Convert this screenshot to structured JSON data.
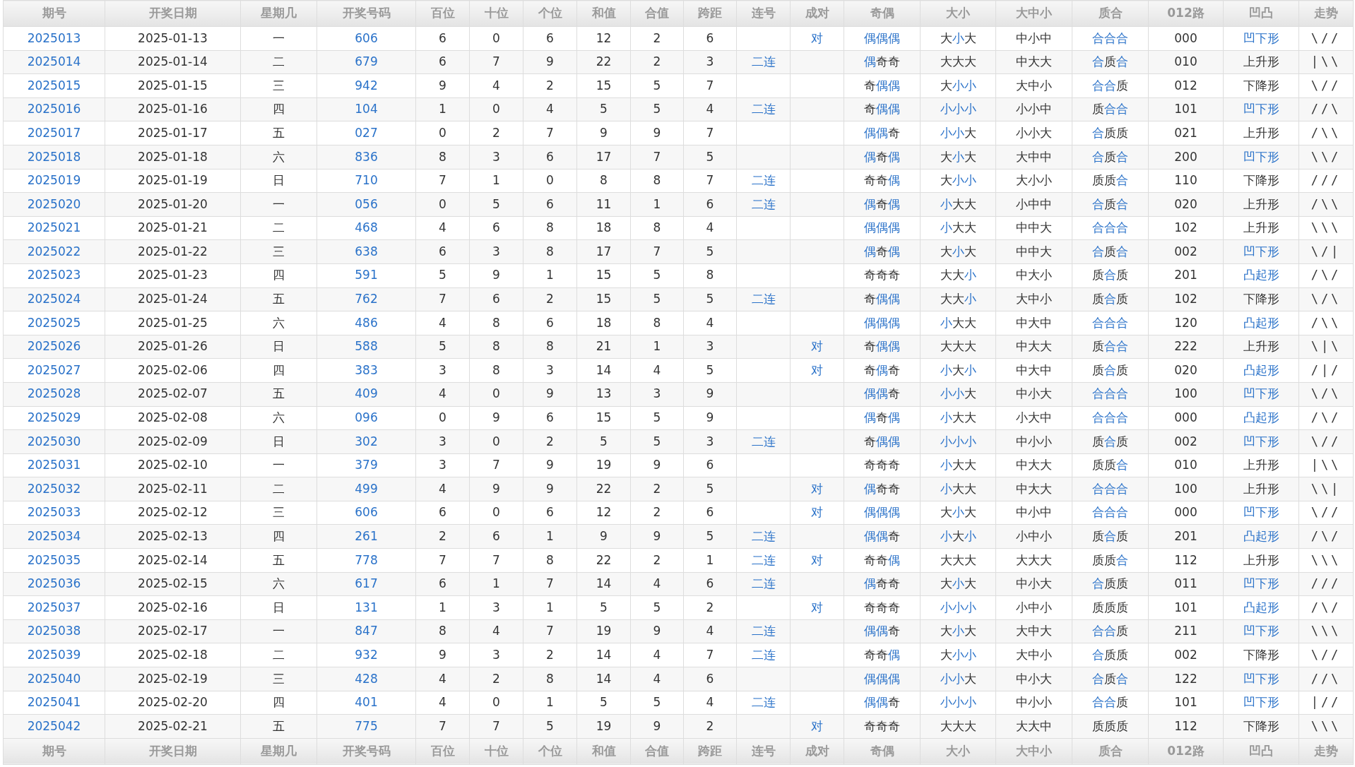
{
  "header": [
    "期号",
    "开奖日期",
    "星期几",
    "开奖号码",
    "百位",
    "十位",
    "个位",
    "和值",
    "合值",
    "跨距",
    "连号",
    "成对",
    "奇偶",
    "大小",
    "大中小",
    "质合",
    "012路",
    "凹凸",
    "走势"
  ],
  "rows": [
    {
      "issue": "2025013",
      "date": "2025-01-13",
      "weekday": "一",
      "number": "606",
      "hundreds": "6",
      "tens": "0",
      "units": "6",
      "sum": "12",
      "sum_tail": "2",
      "span": "6",
      "pair": "对",
      "odd_even": {
        "text": "偶偶偶",
        "highlighted": [
          true,
          true,
          true
        ]
      },
      "big_small": {
        "text": "大小大",
        "highlighted": [
          false,
          true,
          false
        ]
      },
      "big_mid_small": "中小中",
      "prime_composite": {
        "text": "合合合",
        "highlighted": [
          true,
          true,
          true
        ]
      },
      "route_012": "000",
      "shape": {
        "text": "凹下形",
        "highlighted": true
      },
      "trend": "\\//"
    },
    {
      "issue": "2025014",
      "date": "2025-01-14",
      "weekday": "二",
      "number": "679",
      "hundreds": "6",
      "tens": "7",
      "units": "9",
      "sum": "22",
      "sum_tail": "2",
      "span": "3",
      "consecutive": "二连",
      "odd_even": {
        "text": "偶奇奇",
        "highlighted": [
          true,
          false,
          false
        ]
      },
      "big_small": {
        "text": "大大大",
        "highlighted": [
          false,
          false,
          false
        ]
      },
      "big_mid_small": "中大大",
      "prime_composite": {
        "text": "合质合",
        "highlighted": [
          true,
          false,
          true
        ]
      },
      "route_012": "010",
      "shape": {
        "text": "上升形",
        "highlighted": false
      },
      "trend": "|\\\\"
    },
    {
      "issue": "2025015",
      "date": "2025-01-15",
      "weekday": "三",
      "number": "942",
      "hundreds": "9",
      "tens": "4",
      "units": "2",
      "sum": "15",
      "sum_tail": "5",
      "span": "7",
      "odd_even": {
        "text": "奇偶偶",
        "highlighted": [
          false,
          true,
          true
        ]
      },
      "big_small": {
        "text": "大小小",
        "highlighted": [
          false,
          true,
          true
        ]
      },
      "big_mid_small": "大中小",
      "prime_composite": {
        "text": "合合质",
        "highlighted": [
          true,
          true,
          false
        ]
      },
      "route_012": "012",
      "shape": {
        "text": "下降形",
        "highlighted": false
      },
      "trend": "\\//"
    },
    {
      "issue": "2025016",
      "date": "2025-01-16",
      "weekday": "四",
      "number": "104",
      "hundreds": "1",
      "tens": "0",
      "units": "4",
      "sum": "5",
      "sum_tail": "5",
      "span": "4",
      "consecutive": "二连",
      "odd_even": {
        "text": "奇偶偶",
        "highlighted": [
          false,
          true,
          true
        ]
      },
      "big_small": {
        "text": "小小小",
        "highlighted": [
          true,
          true,
          true
        ]
      },
      "big_mid_small": "小小中",
      "prime_composite": {
        "text": "质合合",
        "highlighted": [
          false,
          true,
          true
        ]
      },
      "route_012": "101",
      "shape": {
        "text": "凹下形",
        "highlighted": true
      },
      "trend": "//\\"
    },
    {
      "issue": "2025017",
      "date": "2025-01-17",
      "weekday": "五",
      "number": "027",
      "hundreds": "0",
      "tens": "2",
      "units": "7",
      "sum": "9",
      "sum_tail": "9",
      "span": "7",
      "odd_even": {
        "text": "偶偶奇",
        "highlighted": [
          true,
          true,
          false
        ]
      },
      "big_small": {
        "text": "小小大",
        "highlighted": [
          true,
          true,
          false
        ]
      },
      "big_mid_small": "小小大",
      "prime_composite": {
        "text": "合质质",
        "highlighted": [
          true,
          false,
          false
        ]
      },
      "route_012": "021",
      "shape": {
        "text": "上升形",
        "highlighted": false
      },
      "trend": "/\\\\"
    },
    {
      "issue": "2025018",
      "date": "2025-01-18",
      "weekday": "六",
      "number": "836",
      "hundreds": "8",
      "tens": "3",
      "units": "6",
      "sum": "17",
      "sum_tail": "7",
      "span": "5",
      "odd_even": {
        "text": "偶奇偶",
        "highlighted": [
          true,
          false,
          true
        ]
      },
      "big_small": {
        "text": "大小大",
        "highlighted": [
          false,
          true,
          false
        ]
      },
      "big_mid_small": "大中中",
      "prime_composite": {
        "text": "合质合",
        "highlighted": [
          true,
          false,
          true
        ]
      },
      "route_012": "200",
      "shape": {
        "text": "凹下形",
        "highlighted": true
      },
      "trend": "\\\\/"
    },
    {
      "issue": "2025019",
      "date": "2025-01-19",
      "weekday": "日",
      "number": "710",
      "hundreds": "7",
      "tens": "1",
      "units": "0",
      "sum": "8",
      "sum_tail": "8",
      "span": "7",
      "consecutive": "二连",
      "odd_even": {
        "text": "奇奇偶",
        "highlighted": [
          false,
          false,
          true
        ]
      },
      "big_small": {
        "text": "大小小",
        "highlighted": [
          false,
          true,
          true
        ]
      },
      "big_mid_small": "大小小",
      "prime_composite": {
        "text": "质质合",
        "highlighted": [
          false,
          false,
          true
        ]
      },
      "route_012": "110",
      "shape": {
        "text": "下降形",
        "highlighted": false
      },
      "trend": "///"
    },
    {
      "issue": "2025020",
      "date": "2025-01-20",
      "weekday": "一",
      "number": "056",
      "hundreds": "0",
      "tens": "5",
      "units": "6",
      "sum": "11",
      "sum_tail": "1",
      "span": "6",
      "consecutive": "二连",
      "odd_even": {
        "text": "偶奇偶",
        "highlighted": [
          true,
          false,
          true
        ]
      },
      "big_small": {
        "text": "小大大",
        "highlighted": [
          true,
          false,
          false
        ]
      },
      "big_mid_small": "小中中",
      "prime_composite": {
        "text": "合质合",
        "highlighted": [
          true,
          false,
          true
        ]
      },
      "route_012": "020",
      "shape": {
        "text": "上升形",
        "highlighted": false
      },
      "trend": "/\\\\"
    },
    {
      "issue": "2025021",
      "date": "2025-01-21",
      "weekday": "二",
      "number": "468",
      "hundreds": "4",
      "tens": "6",
      "units": "8",
      "sum": "18",
      "sum_tail": "8",
      "span": "4",
      "odd_even": {
        "text": "偶偶偶",
        "highlighted": [
          true,
          true,
          true
        ]
      },
      "big_small": {
        "text": "小大大",
        "highlighted": [
          true,
          false,
          false
        ]
      },
      "big_mid_small": "中中大",
      "prime_composite": {
        "text": "合合合",
        "highlighted": [
          true,
          true,
          true
        ]
      },
      "route_012": "102",
      "shape": {
        "text": "上升形",
        "highlighted": false
      },
      "trend": "\\\\\\"
    },
    {
      "issue": "2025022",
      "date": "2025-01-22",
      "weekday": "三",
      "number": "638",
      "hundreds": "6",
      "tens": "3",
      "units": "8",
      "sum": "17",
      "sum_tail": "7",
      "span": "5",
      "odd_even": {
        "text": "偶奇偶",
        "highlighted": [
          true,
          false,
          true
        ]
      },
      "big_small": {
        "text": "大小大",
        "highlighted": [
          false,
          true,
          false
        ]
      },
      "big_mid_small": "中中大",
      "prime_composite": {
        "text": "合质合",
        "highlighted": [
          true,
          false,
          true
        ]
      },
      "route_012": "002",
      "shape": {
        "text": "凹下形",
        "highlighted": true
      },
      "trend": "\\/|"
    },
    {
      "issue": "2025023",
      "date": "2025-01-23",
      "weekday": "四",
      "number": "591",
      "hundreds": "5",
      "tens": "9",
      "units": "1",
      "sum": "15",
      "sum_tail": "5",
      "span": "8",
      "odd_even": {
        "text": "奇奇奇",
        "highlighted": [
          false,
          false,
          false
        ]
      },
      "big_small": {
        "text": "大大小",
        "highlighted": [
          false,
          false,
          true
        ]
      },
      "big_mid_small": "中大小",
      "prime_composite": {
        "text": "质合质",
        "highlighted": [
          false,
          true,
          false
        ]
      },
      "route_012": "201",
      "shape": {
        "text": "凸起形",
        "highlighted": true
      },
      "trend": "/\\/"
    },
    {
      "issue": "2025024",
      "date": "2025-01-24",
      "weekday": "五",
      "number": "762",
      "hundreds": "7",
      "tens": "6",
      "units": "2",
      "sum": "15",
      "sum_tail": "5",
      "span": "5",
      "consecutive": "二连",
      "odd_even": {
        "text": "奇偶偶",
        "highlighted": [
          false,
          true,
          true
        ]
      },
      "big_small": {
        "text": "大大小",
        "highlighted": [
          false,
          false,
          true
        ]
      },
      "big_mid_small": "大中小",
      "prime_composite": {
        "text": "质合质",
        "highlighted": [
          false,
          true,
          false
        ]
      },
      "route_012": "102",
      "shape": {
        "text": "下降形",
        "highlighted": false
      },
      "trend": "\\/\\"
    },
    {
      "issue": "2025025",
      "date": "2025-01-25",
      "weekday": "六",
      "number": "486",
      "hundreds": "4",
      "tens": "8",
      "units": "6",
      "sum": "18",
      "sum_tail": "8",
      "span": "4",
      "odd_even": {
        "text": "偶偶偶",
        "highlighted": [
          true,
          true,
          true
        ]
      },
      "big_small": {
        "text": "小大大",
        "highlighted": [
          true,
          false,
          false
        ]
      },
      "big_mid_small": "中大中",
      "prime_composite": {
        "text": "合合合",
        "highlighted": [
          true,
          true,
          true
        ]
      },
      "route_012": "120",
      "shape": {
        "text": "凸起形",
        "highlighted": true
      },
      "trend": "/\\\\"
    },
    {
      "issue": "2025026",
      "date": "2025-01-26",
      "weekday": "日",
      "number": "588",
      "hundreds": "5",
      "tens": "8",
      "units": "8",
      "sum": "21",
      "sum_tail": "1",
      "span": "3",
      "pair": "对",
      "odd_even": {
        "text": "奇偶偶",
        "highlighted": [
          false,
          true,
          true
        ]
      },
      "big_small": {
        "text": "大大大",
        "highlighted": [
          false,
          false,
          false
        ]
      },
      "big_mid_small": "中大大",
      "prime_composite": {
        "text": "质合合",
        "highlighted": [
          false,
          true,
          true
        ]
      },
      "route_012": "222",
      "shape": {
        "text": "上升形",
        "highlighted": false
      },
      "trend": "\\|\\"
    },
    {
      "issue": "2025027",
      "date": "2025-02-06",
      "weekday": "四",
      "number": "383",
      "hundreds": "3",
      "tens": "8",
      "units": "3",
      "sum": "14",
      "sum_tail": "4",
      "span": "5",
      "pair": "对",
      "odd_even": {
        "text": "奇偶奇",
        "highlighted": [
          false,
          true,
          false
        ]
      },
      "big_small": {
        "text": "小大小",
        "highlighted": [
          true,
          false,
          true
        ]
      },
      "big_mid_small": "中大中",
      "prime_composite": {
        "text": "质合质",
        "highlighted": [
          false,
          true,
          false
        ]
      },
      "route_012": "020",
      "shape": {
        "text": "凸起形",
        "highlighted": true
      },
      "trend": "/|/"
    },
    {
      "issue": "2025028",
      "date": "2025-02-07",
      "weekday": "五",
      "number": "409",
      "hundreds": "4",
      "tens": "0",
      "units": "9",
      "sum": "13",
      "sum_tail": "3",
      "span": "9",
      "odd_even": {
        "text": "偶偶奇",
        "highlighted": [
          true,
          true,
          false
        ]
      },
      "big_small": {
        "text": "小小大",
        "highlighted": [
          true,
          true,
          false
        ]
      },
      "big_mid_small": "中小大",
      "prime_composite": {
        "text": "合合合",
        "highlighted": [
          true,
          true,
          true
        ]
      },
      "route_012": "100",
      "shape": {
        "text": "凹下形",
        "highlighted": true
      },
      "trend": "\\/\\"
    },
    {
      "issue": "2025029",
      "date": "2025-02-08",
      "weekday": "六",
      "number": "096",
      "hundreds": "0",
      "tens": "9",
      "units": "6",
      "sum": "15",
      "sum_tail": "5",
      "span": "9",
      "odd_even": {
        "text": "偶奇偶",
        "highlighted": [
          true,
          false,
          true
        ]
      },
      "big_small": {
        "text": "小大大",
        "highlighted": [
          true,
          false,
          false
        ]
      },
      "big_mid_small": "小大中",
      "prime_composite": {
        "text": "合合合",
        "highlighted": [
          true,
          true,
          true
        ]
      },
      "route_012": "000",
      "shape": {
        "text": "凸起形",
        "highlighted": true
      },
      "trend": "/\\/"
    },
    {
      "issue": "2025030",
      "date": "2025-02-09",
      "weekday": "日",
      "number": "302",
      "hundreds": "3",
      "tens": "0",
      "units": "2",
      "sum": "5",
      "sum_tail": "5",
      "span": "3",
      "consecutive": "二连",
      "odd_even": {
        "text": "奇偶偶",
        "highlighted": [
          false,
          true,
          true
        ]
      },
      "big_small": {
        "text": "小小小",
        "highlighted": [
          true,
          true,
          true
        ]
      },
      "big_mid_small": "中小小",
      "prime_composite": {
        "text": "质合质",
        "highlighted": [
          false,
          true,
          false
        ]
      },
      "route_012": "002",
      "shape": {
        "text": "凹下形",
        "highlighted": true
      },
      "trend": "\\//"
    },
    {
      "issue": "2025031",
      "date": "2025-02-10",
      "weekday": "一",
      "number": "379",
      "hundreds": "3",
      "tens": "7",
      "units": "9",
      "sum": "19",
      "sum_tail": "9",
      "span": "6",
      "odd_even": {
        "text": "奇奇奇",
        "highlighted": [
          false,
          false,
          false
        ]
      },
      "big_small": {
        "text": "小大大",
        "highlighted": [
          true,
          false,
          false
        ]
      },
      "big_mid_small": "中大大",
      "prime_composite": {
        "text": "质质合",
        "highlighted": [
          false,
          false,
          true
        ]
      },
      "route_012": "010",
      "shape": {
        "text": "上升形",
        "highlighted": false
      },
      "trend": "|\\\\"
    },
    {
      "issue": "2025032",
      "date": "2025-02-11",
      "weekday": "二",
      "number": "499",
      "hundreds": "4",
      "tens": "9",
      "units": "9",
      "sum": "22",
      "sum_tail": "2",
      "span": "5",
      "pair": "对",
      "odd_even": {
        "text": "偶奇奇",
        "highlighted": [
          true,
          false,
          false
        ]
      },
      "big_small": {
        "text": "小大大",
        "highlighted": [
          true,
          false,
          false
        ]
      },
      "big_mid_small": "中大大",
      "prime_composite": {
        "text": "合合合",
        "highlighted": [
          true,
          true,
          true
        ]
      },
      "route_012": "100",
      "shape": {
        "text": "上升形",
        "highlighted": false
      },
      "trend": "\\\\|"
    },
    {
      "issue": "2025033",
      "date": "2025-02-12",
      "weekday": "三",
      "number": "606",
      "hundreds": "6",
      "tens": "0",
      "units": "6",
      "sum": "12",
      "sum_tail": "2",
      "span": "6",
      "pair": "对",
      "odd_even": {
        "text": "偶偶偶",
        "highlighted": [
          true,
          true,
          true
        ]
      },
      "big_small": {
        "text": "大小大",
        "highlighted": [
          false,
          true,
          false
        ]
      },
      "big_mid_small": "中小中",
      "prime_composite": {
        "text": "合合合",
        "highlighted": [
          true,
          true,
          true
        ]
      },
      "route_012": "000",
      "shape": {
        "text": "凹下形",
        "highlighted": true
      },
      "trend": "\\//"
    },
    {
      "issue": "2025034",
      "date": "2025-02-13",
      "weekday": "四",
      "number": "261",
      "hundreds": "2",
      "tens": "6",
      "units": "1",
      "sum": "9",
      "sum_tail": "9",
      "span": "5",
      "consecutive": "二连",
      "odd_even": {
        "text": "偶偶奇",
        "highlighted": [
          true,
          true,
          false
        ]
      },
      "big_small": {
        "text": "小大小",
        "highlighted": [
          true,
          false,
          true
        ]
      },
      "big_mid_small": "小中小",
      "prime_composite": {
        "text": "质合质",
        "highlighted": [
          false,
          true,
          false
        ]
      },
      "route_012": "201",
      "shape": {
        "text": "凸起形",
        "highlighted": true
      },
      "trend": "/\\/"
    },
    {
      "issue": "2025035",
      "date": "2025-02-14",
      "weekday": "五",
      "number": "778",
      "hundreds": "7",
      "tens": "7",
      "units": "8",
      "sum": "22",
      "sum_tail": "2",
      "span": "1",
      "consecutive": "二连",
      "pair": "对",
      "odd_even": {
        "text": "奇奇偶",
        "highlighted": [
          false,
          false,
          true
        ]
      },
      "big_small": {
        "text": "大大大",
        "highlighted": [
          false,
          false,
          false
        ]
      },
      "big_mid_small": "大大大",
      "prime_composite": {
        "text": "质质合",
        "highlighted": [
          false,
          false,
          true
        ]
      },
      "route_012": "112",
      "shape": {
        "text": "上升形",
        "highlighted": false
      },
      "trend": "\\\\\\"
    },
    {
      "issue": "2025036",
      "date": "2025-02-15",
      "weekday": "六",
      "number": "617",
      "hundreds": "6",
      "tens": "1",
      "units": "7",
      "sum": "14",
      "sum_tail": "4",
      "span": "6",
      "consecutive": "二连",
      "odd_even": {
        "text": "偶奇奇",
        "highlighted": [
          true,
          false,
          false
        ]
      },
      "big_small": {
        "text": "大小大",
        "highlighted": [
          false,
          true,
          false
        ]
      },
      "big_mid_small": "中小大",
      "prime_composite": {
        "text": "合质质",
        "highlighted": [
          true,
          false,
          false
        ]
      },
      "route_012": "011",
      "shape": {
        "text": "凹下形",
        "highlighted": true
      },
      "trend": "///"
    },
    {
      "issue": "2025037",
      "date": "2025-02-16",
      "weekday": "日",
      "number": "131",
      "hundreds": "1",
      "tens": "3",
      "units": "1",
      "sum": "5",
      "sum_tail": "5",
      "span": "2",
      "pair": "对",
      "odd_even": {
        "text": "奇奇奇",
        "highlighted": [
          false,
          false,
          false
        ]
      },
      "big_small": {
        "text": "小小小",
        "highlighted": [
          true,
          true,
          true
        ]
      },
      "big_mid_small": "小中小",
      "prime_composite": {
        "text": "质质质",
        "highlighted": [
          false,
          false,
          false
        ]
      },
      "route_012": "101",
      "shape": {
        "text": "凸起形",
        "highlighted": true
      },
      "trend": "/\\/"
    },
    {
      "issue": "2025038",
      "date": "2025-02-17",
      "weekday": "一",
      "number": "847",
      "hundreds": "8",
      "tens": "4",
      "units": "7",
      "sum": "19",
      "sum_tail": "9",
      "span": "4",
      "consecutive": "二连",
      "odd_even": {
        "text": "偶偶奇",
        "highlighted": [
          true,
          true,
          false
        ]
      },
      "big_small": {
        "text": "大小大",
        "highlighted": [
          false,
          true,
          false
        ]
      },
      "big_mid_small": "大中大",
      "prime_composite": {
        "text": "合合质",
        "highlighted": [
          true,
          true,
          false
        ]
      },
      "route_012": "211",
      "shape": {
        "text": "凹下形",
        "highlighted": true
      },
      "trend": "\\\\\\"
    },
    {
      "issue": "2025039",
      "date": "2025-02-18",
      "weekday": "二",
      "number": "932",
      "hundreds": "9",
      "tens": "3",
      "units": "2",
      "sum": "14",
      "sum_tail": "4",
      "span": "7",
      "consecutive": "二连",
      "odd_even": {
        "text": "奇奇偶",
        "highlighted": [
          false,
          false,
          true
        ]
      },
      "big_small": {
        "text": "大小小",
        "highlighted": [
          false,
          true,
          true
        ]
      },
      "big_mid_small": "大中小",
      "prime_composite": {
        "text": "合质质",
        "highlighted": [
          true,
          false,
          false
        ]
      },
      "route_012": "002",
      "shape": {
        "text": "下降形",
        "highlighted": false
      },
      "trend": "\\//"
    },
    {
      "issue": "2025040",
      "date": "2025-02-19",
      "weekday": "三",
      "number": "428",
      "hundreds": "4",
      "tens": "2",
      "units": "8",
      "sum": "14",
      "sum_tail": "4",
      "span": "6",
      "odd_even": {
        "text": "偶偶偶",
        "highlighted": [
          true,
          true,
          true
        ]
      },
      "big_small": {
        "text": "小小大",
        "highlighted": [
          true,
          true,
          false
        ]
      },
      "big_mid_small": "中小大",
      "prime_composite": {
        "text": "合质合",
        "highlighted": [
          true,
          false,
          true
        ]
      },
      "route_012": "122",
      "shape": {
        "text": "凹下形",
        "highlighted": true
      },
      "trend": "//\\"
    },
    {
      "issue": "2025041",
      "date": "2025-02-20",
      "weekday": "四",
      "number": "401",
      "hundreds": "4",
      "tens": "0",
      "units": "1",
      "sum": "5",
      "sum_tail": "5",
      "span": "4",
      "consecutive": "二连",
      "odd_even": {
        "text": "偶偶奇",
        "highlighted": [
          true,
          true,
          false
        ]
      },
      "big_small": {
        "text": "小小小",
        "highlighted": [
          true,
          true,
          true
        ]
      },
      "big_mid_small": "中小小",
      "prime_composite": {
        "text": "合合质",
        "highlighted": [
          true,
          true,
          false
        ]
      },
      "route_012": "101",
      "shape": {
        "text": "凹下形",
        "highlighted": true
      },
      "trend": "|//"
    },
    {
      "issue": "2025042",
      "date": "2025-02-21",
      "weekday": "五",
      "number": "775",
      "hundreds": "7",
      "tens": "7",
      "units": "5",
      "sum": "19",
      "sum_tail": "9",
      "span": "2",
      "pair": "对",
      "odd_even": {
        "text": "奇奇奇",
        "highlighted": [
          false,
          false,
          false
        ]
      },
      "big_small": {
        "text": "大大大",
        "highlighted": [
          false,
          false,
          false
        ]
      },
      "big_mid_small": "大大中",
      "prime_composite": {
        "text": "质质质",
        "highlighted": [
          false,
          false,
          false
        ]
      },
      "route_012": "112",
      "shape": {
        "text": "下降形",
        "highlighted": false
      },
      "trend": "\\\\\\"
    }
  ],
  "footer": [
    "期号",
    "开奖日期",
    "星期几",
    "开奖号码",
    "百位",
    "十位",
    "个位",
    "和值",
    "合值",
    "跨距",
    "连号",
    "成对",
    "奇偶",
    "大小",
    "大中小",
    "质合",
    "012路",
    "凹凸",
    "走势"
  ]
}
